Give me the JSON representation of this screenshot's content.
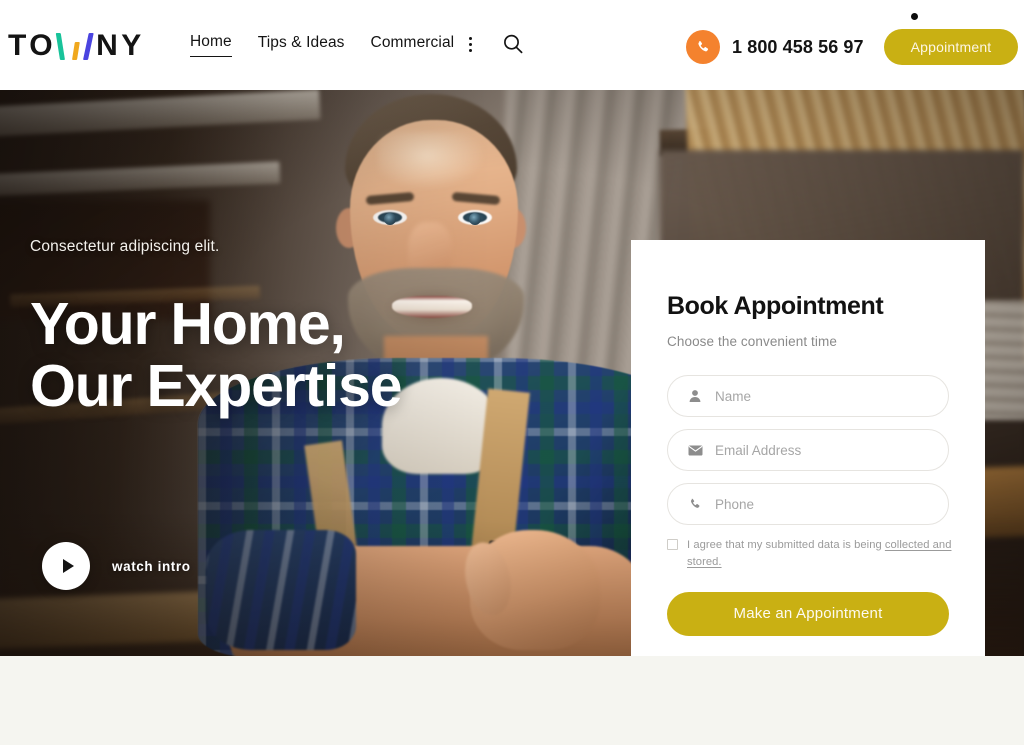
{
  "header": {
    "logo": {
      "before": "TO",
      "after": "NY",
      "full": "TOWNY"
    },
    "nav": [
      {
        "label": "Home",
        "active": true
      },
      {
        "label": "Tips & Ideas",
        "active": false
      },
      {
        "label": "Commercial",
        "active": false
      }
    ],
    "more_menu_icon": "three-dots-vertical-icon",
    "search_icon": "search-icon",
    "phone_icon": "phone-icon",
    "phone_number": "1 800 458 56 97",
    "appointment_label": "Appointment"
  },
  "hero": {
    "eyebrow": "Consectetur adipiscing elit.",
    "title_line1": "Your Home,",
    "title_line2": "Our Expertise",
    "watch_label": "watch intro",
    "play_icon": "play-icon"
  },
  "form": {
    "title": "Book Appointment",
    "subtitle": "Choose the convenient time",
    "fields": [
      {
        "name": "name",
        "placeholder": "Name",
        "value": "",
        "icon": "user-icon"
      },
      {
        "name": "email",
        "placeholder": "Email Address",
        "value": "",
        "icon": "envelope-icon"
      },
      {
        "name": "phone",
        "placeholder": "Phone",
        "value": "",
        "icon": "phone-icon"
      }
    ],
    "consent_text": "I agree that my submitted data is being ",
    "consent_link": "collected and stored.",
    "submit_label": "Make an Appointment"
  },
  "colors": {
    "accent_gold": "#c9b013",
    "accent_orange": "#f4822e",
    "logo_teal": "#18c39a",
    "logo_yellow": "#f0a81e",
    "logo_blue": "#4a44e0",
    "text_dark": "#141414",
    "section_bg": "#f5f5f0"
  }
}
